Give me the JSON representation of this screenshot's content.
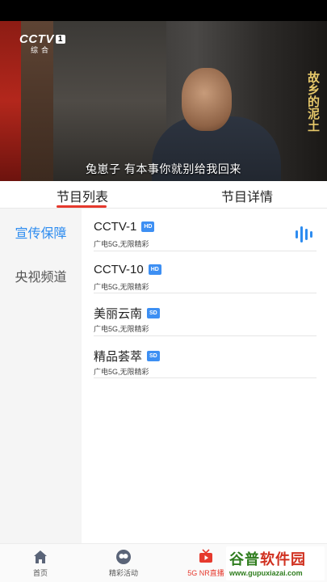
{
  "video": {
    "channel_logo": "CCTV",
    "channel_number": "1",
    "channel_sub": "综合",
    "scroll_title": "故乡的泥土",
    "subtitle": "兔崽子  有本事你就别给我回来"
  },
  "tabs": {
    "list_label": "节目列表",
    "detail_label": "节目详情"
  },
  "sidebar": {
    "items": [
      {
        "label": "宣传保障"
      },
      {
        "label": "央视频道"
      }
    ]
  },
  "channels": [
    {
      "name": "CCTV-1",
      "badge": "HD",
      "sub": "广电5G,无限精彩",
      "playing": true
    },
    {
      "name": "CCTV-10",
      "badge": "HD",
      "sub": "广电5G,无限精彩",
      "playing": false
    },
    {
      "name": "美丽云南",
      "badge": "SD",
      "sub": "广电5G,无限精彩",
      "playing": false
    },
    {
      "name": "精品荟萃",
      "badge": "SD",
      "sub": "广电5G,无限精彩",
      "playing": false
    }
  ],
  "bottom_nav": {
    "items": [
      {
        "label": "首页",
        "icon": "home-icon"
      },
      {
        "label": "精彩活动",
        "icon": "events-icon"
      },
      {
        "label": "5G NR直播",
        "icon": "tv-icon"
      }
    ]
  },
  "watermark": {
    "name_green": "谷普",
    "name_red": "软件园",
    "url": "www.gupuxiazai.com"
  },
  "colors": {
    "accent_blue": "#2d8cf0",
    "accent_red": "#e6392d",
    "badge_blue": "#3d8ff3"
  }
}
